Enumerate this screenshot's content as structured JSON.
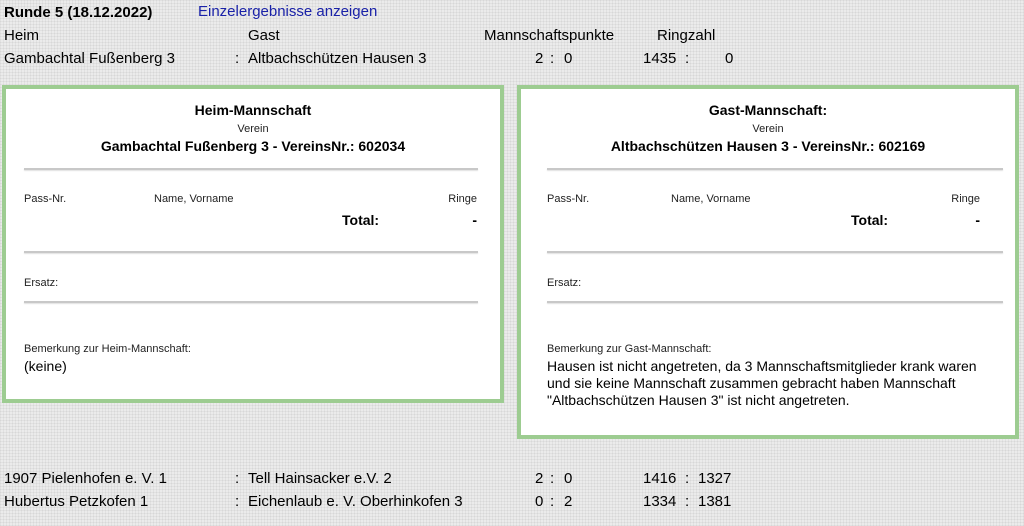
{
  "round": {
    "title": "Runde 5  (18.12.2022)",
    "details_link": "Einzelergebnisse anzeigen"
  },
  "headers": {
    "home": "Heim",
    "guest": "Gast",
    "team_points": "Mannschaftspunkte",
    "ring_count": "Ringzahl"
  },
  "matches": [
    {
      "home": "Gambachtal Fußenberg 3",
      "sep": ":",
      "guest": "Altbachschützen Hausen 3",
      "pts_home": "2",
      "pts_sep": ":",
      "pts_guest": "0",
      "rings_home": "1435",
      "rings_sep": ":",
      "rings_guest": "0"
    },
    {
      "home": "1907 Pielenhofen e. V. 1",
      "sep": ":",
      "guest": "Tell Hainsacker e.V. 2",
      "pts_home": "2",
      "pts_sep": ":",
      "pts_guest": "0",
      "rings_home": "1416",
      "rings_sep": ":",
      "rings_guest": "1327"
    },
    {
      "home": "Hubertus Petzkofen 1",
      "sep": ":",
      "guest": "Eichenlaub e. V. Oberhinkofen 3",
      "pts_home": "0",
      "pts_sep": ":",
      "pts_guest": "2",
      "rings_home": "1334",
      "rings_sep": ":",
      "rings_guest": "1381"
    }
  ],
  "home_panel": {
    "title": "Heim-Mannschaft",
    "club_label": "Verein",
    "club_line": "Gambachtal Fußenberg 3  -  VereinsNr.: 602034",
    "col_pass": "Pass-Nr.",
    "col_name": "Name, Vorname",
    "col_rings": "Ringe",
    "total_label": "Total:",
    "total_value": "-",
    "substitute_label": "Ersatz:",
    "remark_label": "Bemerkung zur Heim-Mannschaft:",
    "remark_text": "(keine)"
  },
  "guest_panel": {
    "title": "Gast-Mannschaft:",
    "club_label": "Verein",
    "club_line": "Altbachschützen Hausen 3  -  VereinsNr.: 602169",
    "col_pass": "Pass-Nr.",
    "col_name": "Name, Vorname",
    "col_rings": "Ringe",
    "total_label": "Total:",
    "total_value": "-",
    "substitute_label": "Ersatz:",
    "remark_label": "Bemerkung zur Gast-Mannschaft:",
    "remark_text": "Hausen ist nicht angetreten, da 3 Mannschaftsmitglieder krank waren und sie keine Mannschaft zusammen gebracht haben Mannschaft \"Altbachschützen Hausen 3\" ist nicht angetreten."
  },
  "colors": {
    "panel_border": "#9dcc91",
    "link": "#1a22a8",
    "background": "#ebebeb"
  }
}
